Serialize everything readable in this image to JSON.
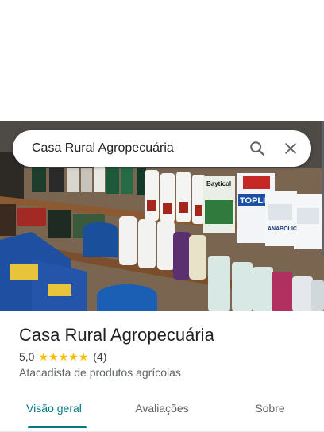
{
  "search": {
    "query": "Casa Rural Agropecuária",
    "search_icon": "search-icon",
    "close_icon": "close-icon"
  },
  "place": {
    "name": "Casa Rural Agropecuária",
    "rating": "5,0",
    "stars": 5,
    "reviews": "(4)",
    "category": "Atacadista de produtos agrícolas"
  },
  "photo": {
    "labels": [
      "Bayticol",
      "TOPLINE",
      "ANABOLIC"
    ]
  },
  "tabs": [
    {
      "label": "Visão geral",
      "active": true
    },
    {
      "label": "Avaliações",
      "active": false
    },
    {
      "label": "Sobre",
      "active": false
    }
  ],
  "colors": {
    "accent": "#007b83",
    "star": "#fbbc04",
    "text": "#202124",
    "secondary": "#5f6368"
  }
}
